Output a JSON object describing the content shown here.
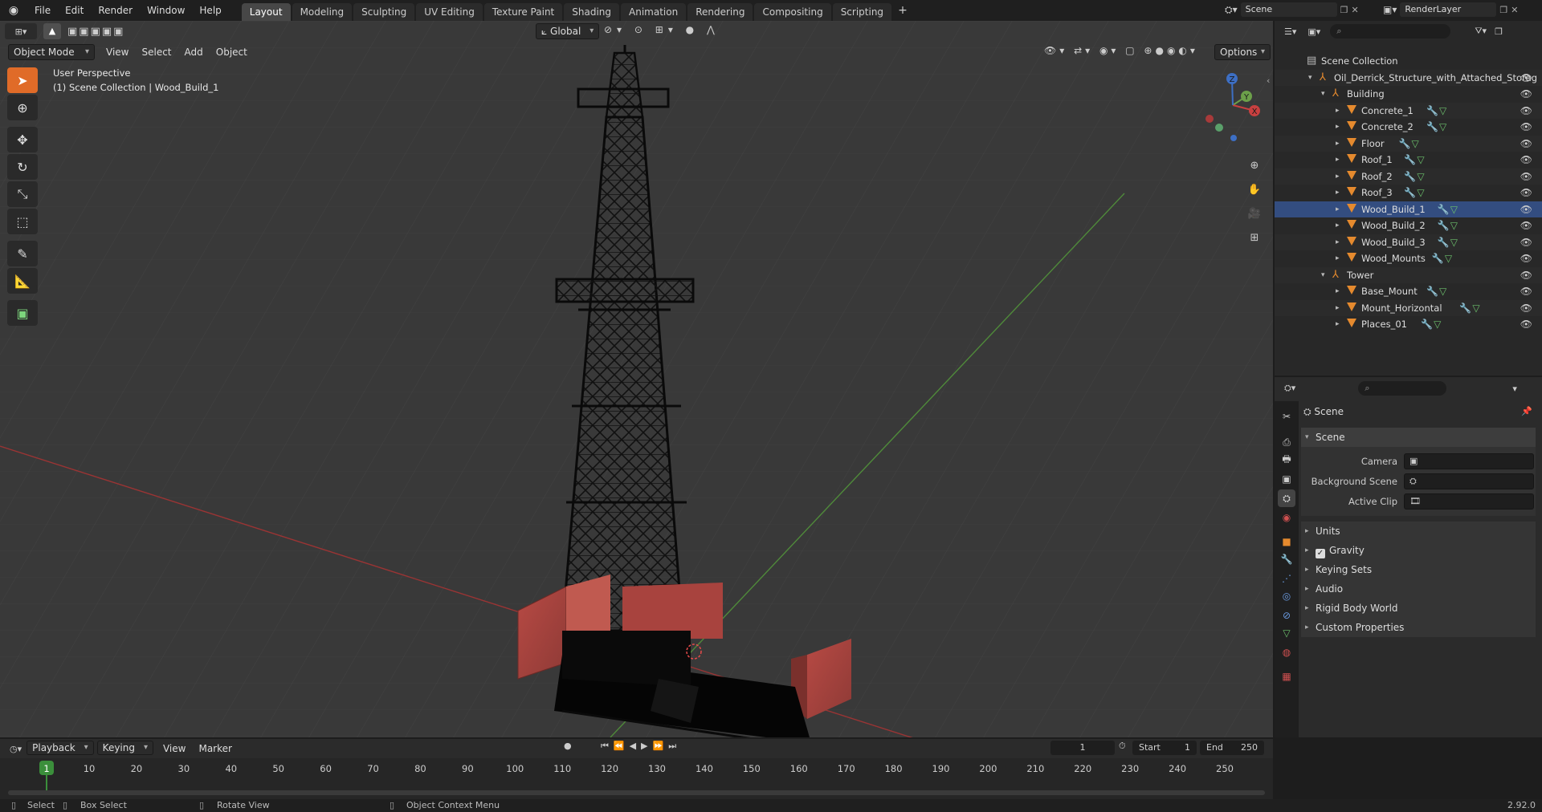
{
  "menubar": [
    "File",
    "Edit",
    "Render",
    "Window",
    "Help"
  ],
  "workspaces": [
    "Layout",
    "Modeling",
    "Sculpting",
    "UV Editing",
    "Texture Paint",
    "Shading",
    "Animation",
    "Rendering",
    "Compositing",
    "Scripting"
  ],
  "active_workspace": "Layout",
  "scene_name": "Scene",
  "render_layer": "RenderLayer",
  "viewport": {
    "mode": "Object Mode",
    "menus": [
      "View",
      "Select",
      "Add",
      "Object"
    ],
    "orientation": "Global",
    "options_label": "Options",
    "overlay_title": "User Perspective",
    "overlay_subtitle": "(1) Scene Collection | Wood_Build_1",
    "gizmo_axes": {
      "x": "X",
      "y": "Y",
      "z": "Z"
    }
  },
  "outliner": {
    "root": "Scene Collection",
    "collection": "Oil_Derrick_Structure_with_Attached_Storag",
    "groups": [
      {
        "name": "Building",
        "children": [
          "Concrete_1",
          "Concrete_2",
          "Floor",
          "Roof_1",
          "Roof_2",
          "Roof_3",
          "Wood_Build_1",
          "Wood_Build_2",
          "Wood_Build_3",
          "Wood_Mounts"
        ]
      },
      {
        "name": "Tower",
        "children": [
          "Base_Mount",
          "Mount_Horizontal",
          "Places_01"
        ]
      }
    ],
    "selected": "Wood_Build_1"
  },
  "properties": {
    "header": "Scene",
    "section": "Scene",
    "fields": [
      {
        "label": "Camera"
      },
      {
        "label": "Background Scene"
      },
      {
        "label": "Active Clip"
      }
    ],
    "panels": [
      "Units",
      "Gravity",
      "Keying Sets",
      "Audio",
      "Rigid Body World",
      "Custom Properties"
    ],
    "gravity_checked": true
  },
  "timeline": {
    "menus": [
      "Playback",
      "Keying",
      "View",
      "Marker"
    ],
    "current_frame": "1",
    "start_label": "Start",
    "start": "1",
    "end_label": "End",
    "end": "250",
    "ticks": [
      "1",
      "10",
      "20",
      "30",
      "40",
      "50",
      "60",
      "70",
      "80",
      "90",
      "100",
      "110",
      "120",
      "130",
      "140",
      "150",
      "160",
      "170",
      "180",
      "190",
      "200",
      "210",
      "220",
      "230",
      "240",
      "250"
    ]
  },
  "statusbar": {
    "select": "Select",
    "box_select": "Box Select",
    "rotate_view": "Rotate View",
    "context_menu": "Object Context Menu",
    "version": "2.92.0"
  },
  "colors": {
    "accent": "#e06b28",
    "x_axis": "#b53838",
    "y_axis": "#5a9a3a",
    "selected_row": "#334d80"
  }
}
